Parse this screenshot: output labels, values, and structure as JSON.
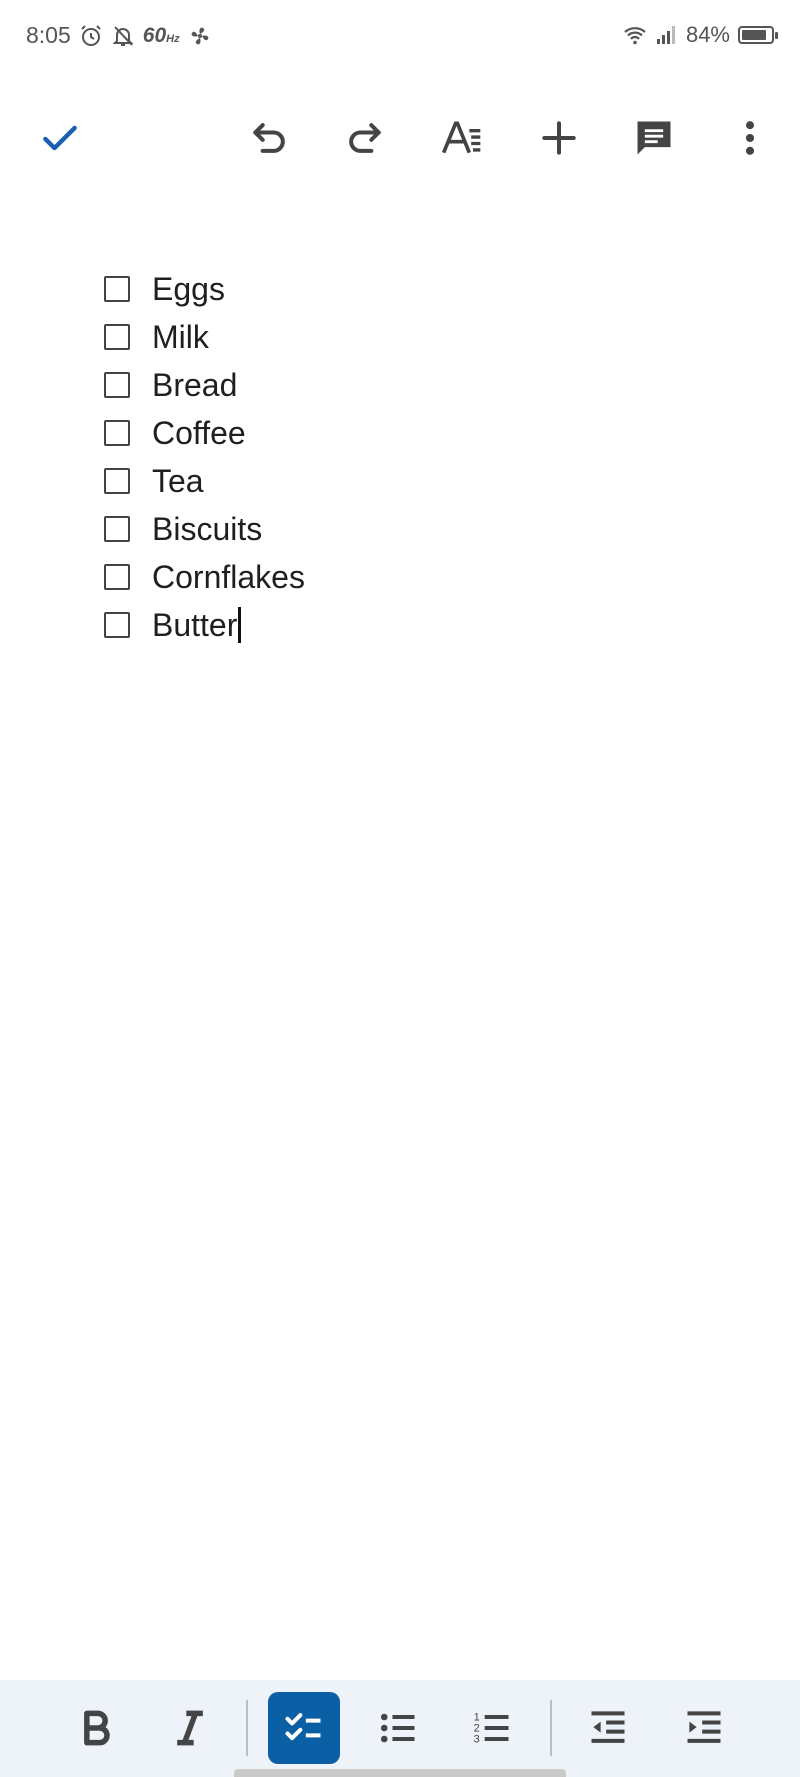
{
  "status_bar": {
    "time": "8:05",
    "refresh_rate": "60",
    "refresh_unit": "Hz",
    "battery_percent": "84%",
    "battery_level": 0.84,
    "icons": [
      "alarm-icon",
      "notifications-off-icon",
      "fan-icon",
      "wifi-icon",
      "signal-icon",
      "battery-icon"
    ]
  },
  "toolbar": {
    "icons": [
      "check-icon",
      "undo-icon",
      "redo-icon",
      "text-format-icon",
      "add-icon",
      "comment-icon",
      "more-vert-icon"
    ],
    "accent_color": "#1a5fb4"
  },
  "checklist": {
    "items": [
      {
        "label": "Eggs",
        "checked": false
      },
      {
        "label": "Milk",
        "checked": false
      },
      {
        "label": "Bread",
        "checked": false
      },
      {
        "label": "Coffee",
        "checked": false
      },
      {
        "label": "Tea",
        "checked": false
      },
      {
        "label": "Biscuits",
        "checked": false
      },
      {
        "label": "Cornflakes",
        "checked": false
      },
      {
        "label": "Butter",
        "checked": false
      }
    ]
  },
  "format_bar": {
    "icons": [
      "bold-icon",
      "italic-icon",
      "checklist-icon",
      "bulleted-list-icon",
      "numbered-list-icon",
      "decrease-indent-icon",
      "increase-indent-icon"
    ],
    "active": "checklist-icon",
    "active_color": "#0b5fa5"
  }
}
